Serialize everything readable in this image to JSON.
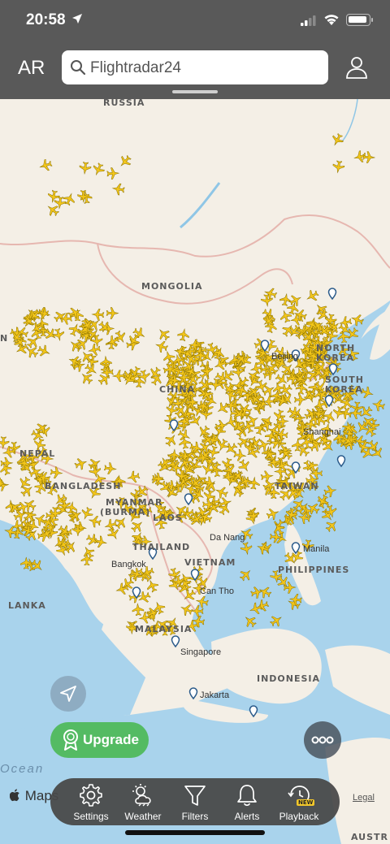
{
  "status_bar": {
    "time": "20:58"
  },
  "header": {
    "ar_label": "AR",
    "search_placeholder": "Flightradar24"
  },
  "map": {
    "country_labels": [
      "RUSSIA",
      "MONGOLIA",
      "CHINA",
      "NORTH",
      "KOREA",
      "SOUTH",
      "KOREA",
      "NEPAL",
      "BANGLADESH",
      "MYANMAR",
      "(BURMA)",
      "LAOS",
      "THAILAND",
      "VIETNAM",
      "PHILIPPINES",
      "MALAYSIA",
      "INDONESIA",
      "TAIWAN",
      "AUSTR",
      "N",
      "LANKA"
    ],
    "city_labels": [
      "Beijing",
      "Shanghai",
      "Da Nang",
      "Bangkok",
      "Manila",
      "Singapore",
      "Jakarta",
      "Can Tho"
    ],
    "ocean_label": "Ocean",
    "colors": {
      "land": "#f4efe6",
      "water": "#a9d3ec",
      "border": "#e6b7b0",
      "aircraft": "#f2c51a",
      "header": "#545454"
    }
  },
  "controls": {
    "upgrade_label": "Upgrade",
    "maps_label": "Maps",
    "legal_label": "Legal"
  },
  "toolbar": {
    "items": [
      {
        "label": "Settings",
        "icon": "gear-icon"
      },
      {
        "label": "Weather",
        "icon": "weather-icon"
      },
      {
        "label": "Filters",
        "icon": "filter-icon"
      },
      {
        "label": "Alerts",
        "icon": "bell-icon"
      },
      {
        "label": "Playback",
        "icon": "playback-icon",
        "badge": "NEW"
      }
    ]
  }
}
